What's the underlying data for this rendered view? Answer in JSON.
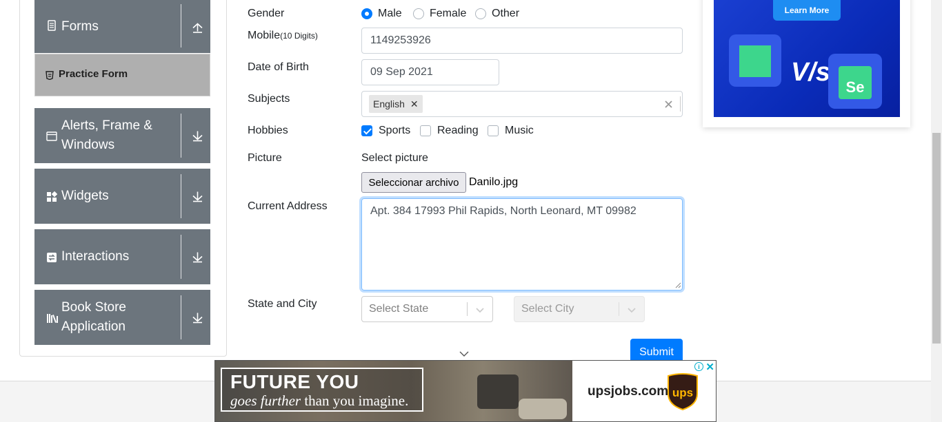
{
  "sidebar": {
    "forms_label": "Forms",
    "practice_form_label": "Practice Form",
    "alerts_label": "Alerts, Frame & Windows",
    "widgets_label": "Widgets",
    "interactions_label": "Interactions",
    "bookstore_label": "Book Store Application"
  },
  "form": {
    "gender_label": "Gender",
    "gender_options": [
      "Male",
      "Female",
      "Other"
    ],
    "gender_selected": "Male",
    "mobile_label": "Mobile",
    "mobile_hint": "(10 Digits)",
    "mobile_value": "1149253926",
    "dob_label": "Date of Birth",
    "dob_value": "09 Sep 2021",
    "subjects_label": "Subjects",
    "subject_tags": [
      "English"
    ],
    "hobbies_label": "Hobbies",
    "hobbies": [
      {
        "label": "Sports",
        "checked": true
      },
      {
        "label": "Reading",
        "checked": false
      },
      {
        "label": "Music",
        "checked": false
      }
    ],
    "picture_label": "Picture",
    "select_picture": "Select picture",
    "file_button": "Seleccionar archivo",
    "file_name": "Danilo.jpg",
    "address_label": "Current Address",
    "address_value": "Apt. 384 17993 Phil Rapids, North Leonard, MT 09982",
    "state_city_label": "State and City",
    "state_placeholder": "Select State",
    "city_placeholder": "Select City",
    "submit_label": "Submit"
  },
  "ad_right": {
    "learn_more": "Learn More",
    "vs_text": "V/s",
    "se_text": "Se"
  },
  "banner": {
    "headline": "FUTURE YOU",
    "subline_italic": "goes further",
    "subline_rest": " than you imagine.",
    "domain": "upsjobs.com",
    "ups_logo_text": "ups",
    "adchoice": "i",
    "close": "✕"
  },
  "colors": {
    "primary": "#007bff",
    "sidebar_group": "#6c757d",
    "sidebar_active": "#afafaf"
  }
}
